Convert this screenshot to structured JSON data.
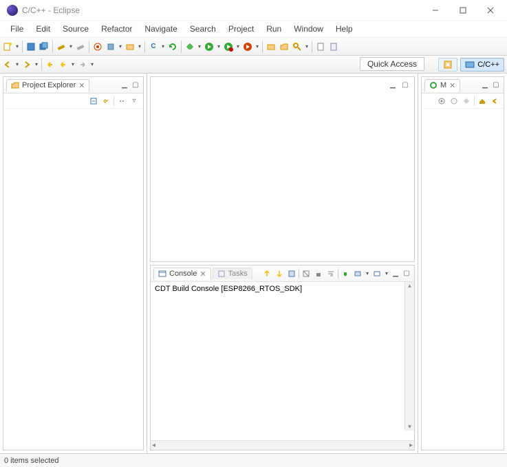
{
  "window": {
    "title": "C/C++ - Eclipse"
  },
  "menu": {
    "file": "File",
    "edit": "Edit",
    "source": "Source",
    "refactor": "Refactor",
    "navigate": "Navigate",
    "search": "Search",
    "project": "Project",
    "run": "Run",
    "window": "Window",
    "help": "Help"
  },
  "quick_access": {
    "label": "Quick Access"
  },
  "perspective": {
    "cpp_label": "C/C++"
  },
  "project_explorer": {
    "title": "Project Explorer"
  },
  "outline": {
    "title_short": "M"
  },
  "console": {
    "tab_console": "Console",
    "tab_tasks": "Tasks",
    "content": "CDT Build Console [ESP8266_RTOS_SDK]"
  },
  "status": {
    "text": "0 items selected"
  }
}
